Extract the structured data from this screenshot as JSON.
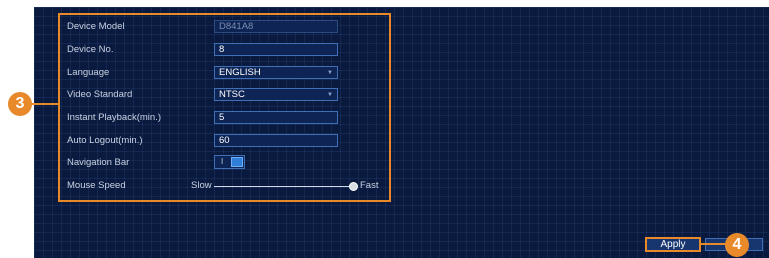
{
  "settings": {
    "rows": [
      {
        "label": "Device Model",
        "value": "D841A8"
      },
      {
        "label": "Device No.",
        "value": "8"
      },
      {
        "label": "Language",
        "value": "ENGLISH"
      },
      {
        "label": "Video Standard",
        "value": "NTSC"
      },
      {
        "label": "Instant Playback(min.)",
        "value": "5"
      },
      {
        "label": "Auto Logout(min.)",
        "value": "60"
      },
      {
        "label": "Navigation Bar",
        "value": "I"
      },
      {
        "label": "Mouse Speed"
      }
    ],
    "mouse_speed": {
      "min_label": "Slow",
      "max_label": "Fast",
      "level": 1.0
    },
    "navigation_bar_enabled": true
  },
  "callouts": {
    "step3": "3",
    "step4": "4"
  },
  "buttons": {
    "apply": "Apply"
  },
  "colors": {
    "accent": "#e8892a",
    "background": "#0a1a3e",
    "field_border": "#3f6fb5"
  }
}
